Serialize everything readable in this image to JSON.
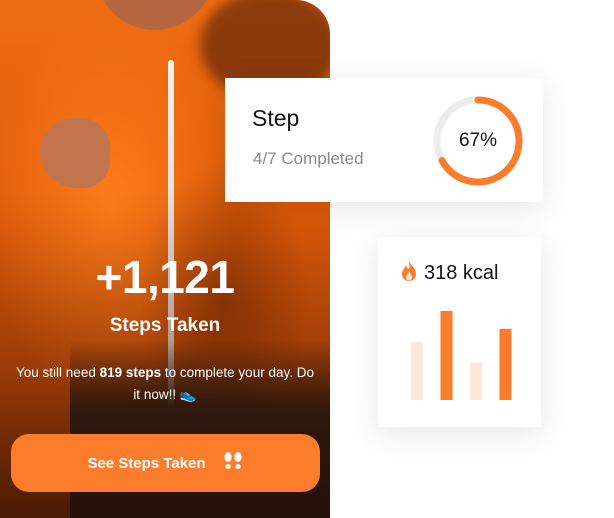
{
  "hero": {
    "steps_count": "+1,121",
    "steps_label": "Steps Taken",
    "need_prefix": "You still need ",
    "need_steps": "819 steps",
    "need_suffix": " to complete your day. Do it now!!",
    "cta_label": "See Steps Taken",
    "cta_icon": "footprints-icon"
  },
  "step_card": {
    "title": "Step",
    "completed_text": "4/7 Completed",
    "percent_label": "67%",
    "progress": 0.67
  },
  "kcal_card": {
    "icon": "flame-icon",
    "value": "318 kcal",
    "bars": [
      0.65,
      1.0,
      0.42,
      0.8
    ],
    "bar_highlight": [
      false,
      true,
      false,
      true
    ]
  },
  "colors": {
    "accent": "#fb7d2c",
    "accent_light": "#fde6da",
    "ring_track": "#ececec"
  }
}
